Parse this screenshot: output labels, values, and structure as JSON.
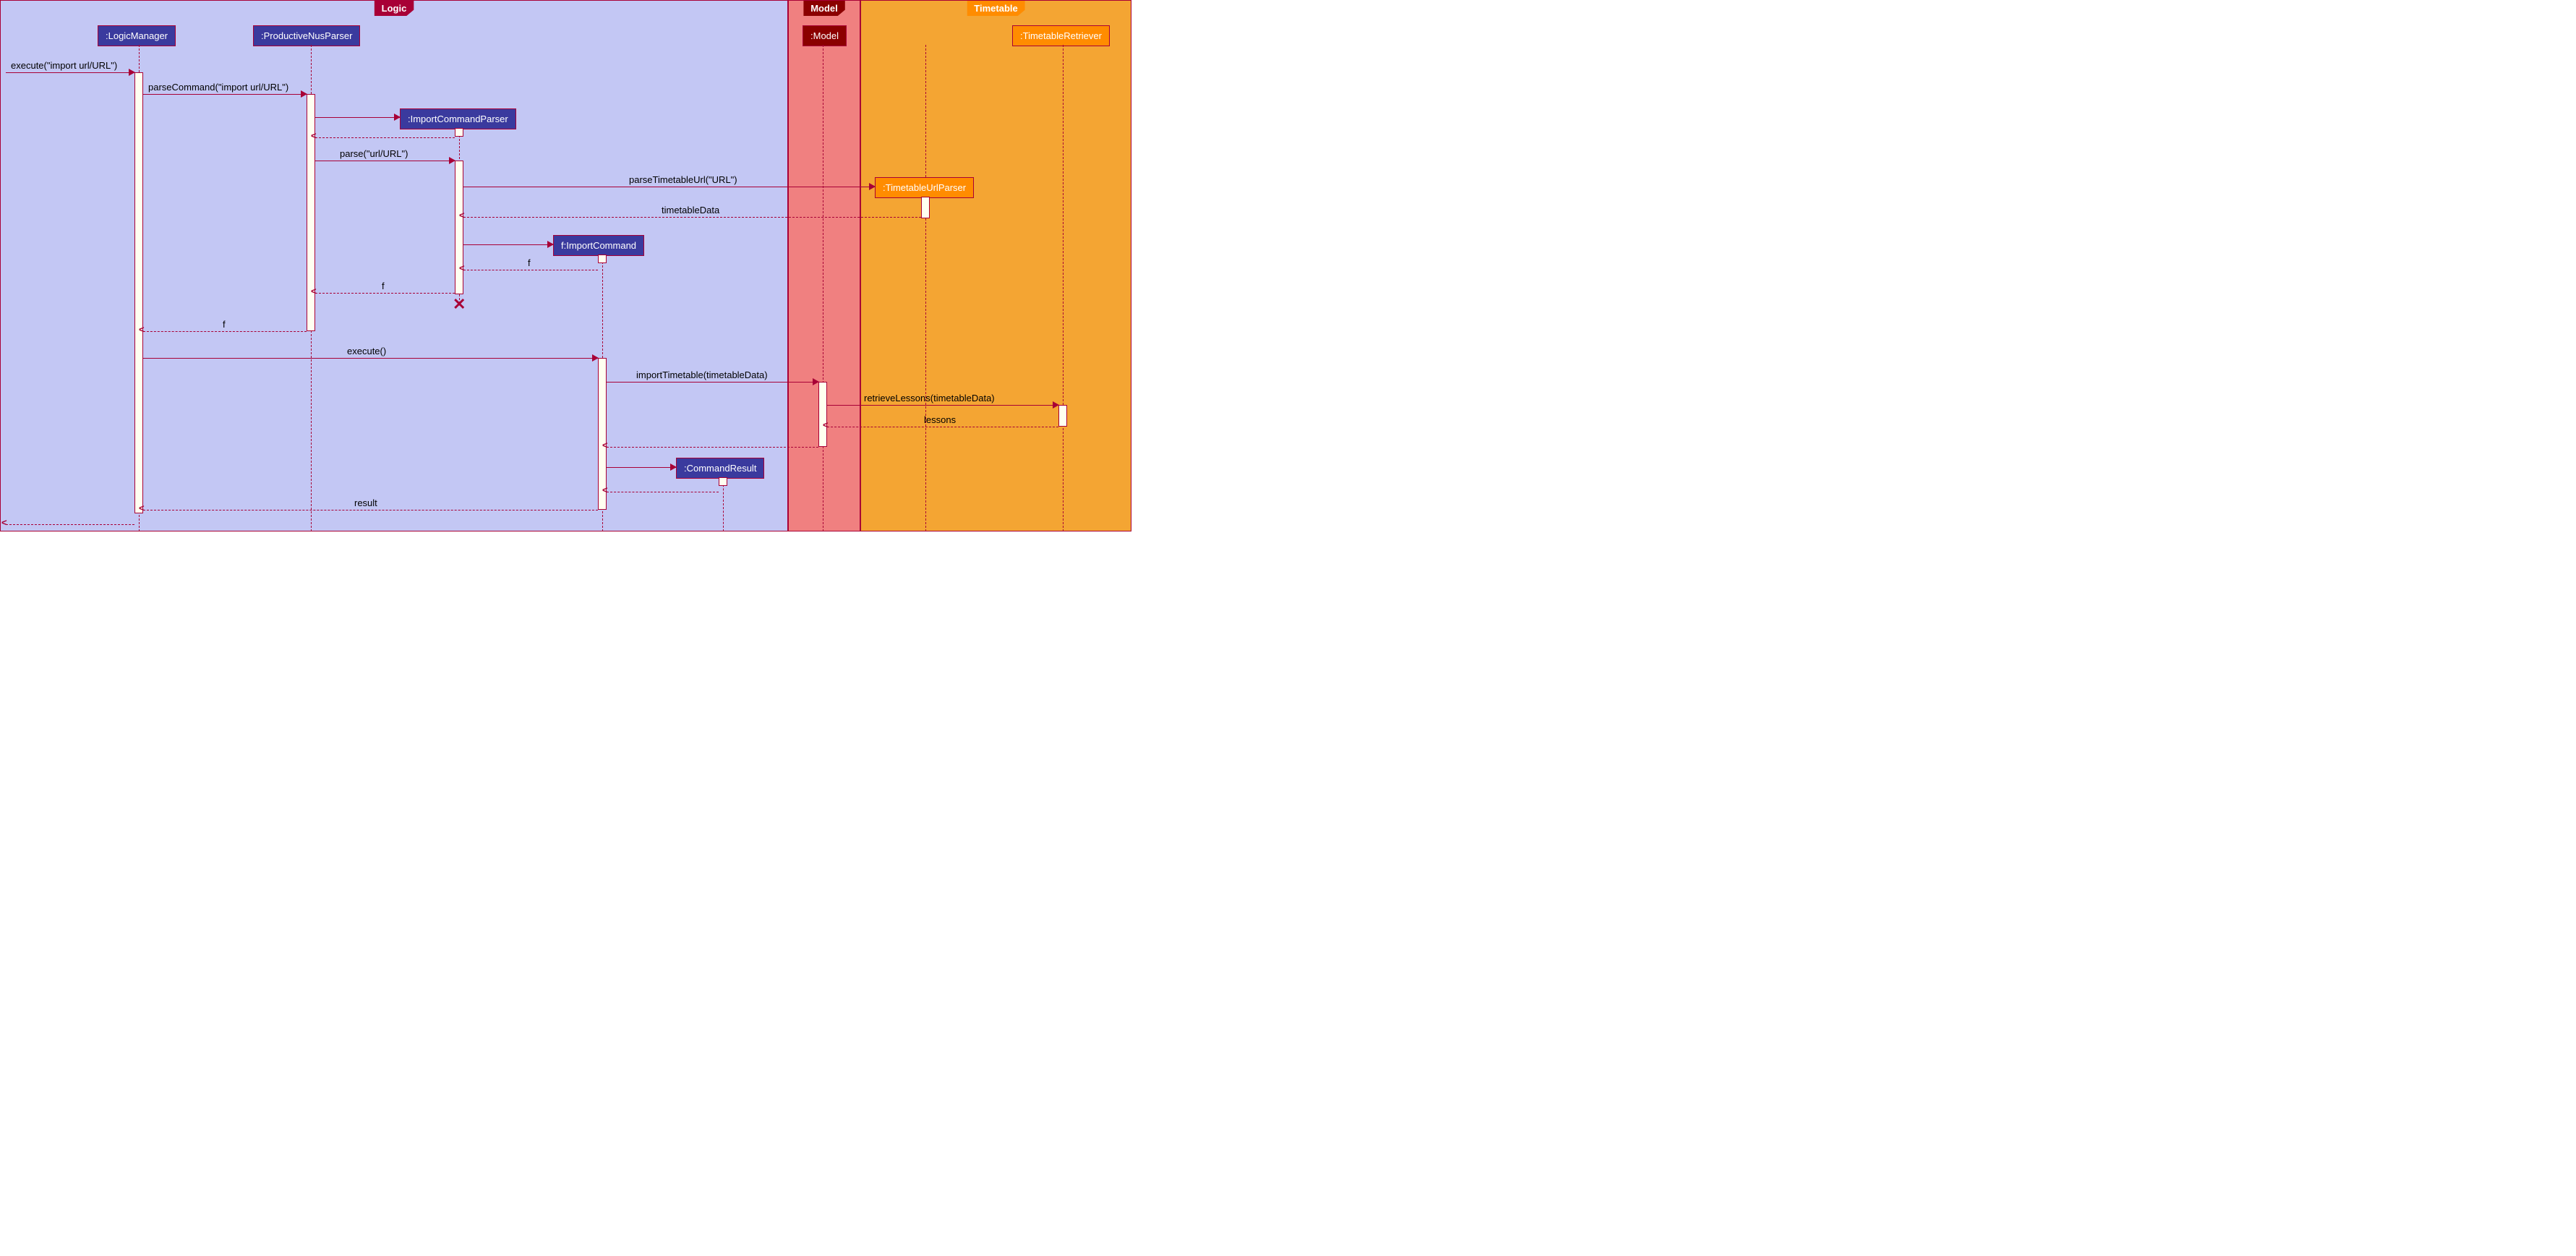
{
  "frames": {
    "logic": "Logic",
    "model": "Model",
    "timetable": "Timetable"
  },
  "participants": {
    "logicManager": ":LogicManager",
    "productiveNusParser": ":ProductiveNusParser",
    "importCommandParser": ":ImportCommandParser",
    "importCommand": "f:ImportCommand",
    "commandResult": ":CommandResult",
    "model": ":Model",
    "timetableUrlParser": ":TimetableUrlParser",
    "timetableRetriever": ":TimetableRetriever"
  },
  "messages": {
    "execute1": "execute(\"import url/URL\")",
    "parseCommand": "parseCommand(\"import url/URL\")",
    "parse": "parse(\"url/URL\")",
    "parseTimetableUrl": "parseTimetableUrl(\"URL\")",
    "timetableData": "timetableData",
    "f1": "f",
    "f2": "f",
    "f3": "f",
    "execute2": "execute()",
    "importTimetable": "importTimetable(timetableData)",
    "retrieveLessons": "retrieveLessons(timetableData)",
    "lessons": "lessons",
    "result": "result"
  }
}
